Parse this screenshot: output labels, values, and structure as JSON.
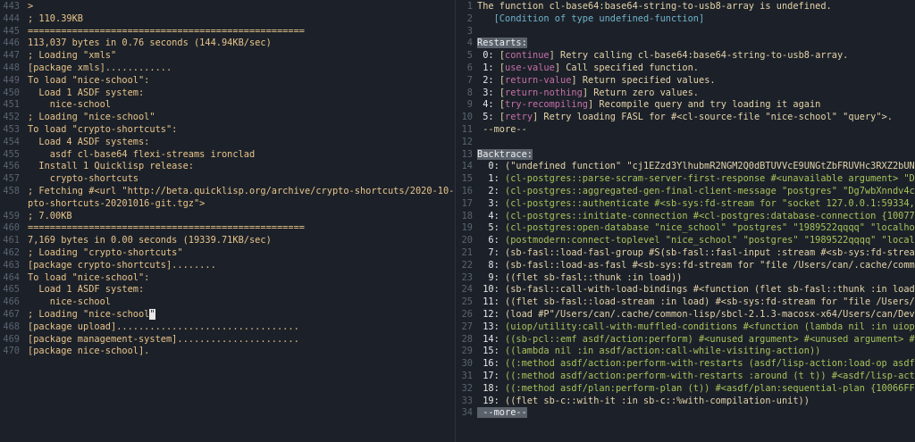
{
  "left_pane": {
    "lines": [
      {
        "n": "443",
        "t": ">"
      },
      {
        "n": "444",
        "t": "; 110.39KB"
      },
      {
        "n": "445",
        "t": "=================================================="
      },
      {
        "n": "446",
        "t": "113,037 bytes in 0.76 seconds (144.94KB/sec)"
      },
      {
        "n": "447",
        "t": "; Loading \"xmls\""
      },
      {
        "n": "448",
        "t": "[package xmls]............"
      },
      {
        "n": "449",
        "t": "To load \"nice-school\":"
      },
      {
        "n": "450",
        "t": "  Load 1 ASDF system:"
      },
      {
        "n": "451",
        "t": "    nice-school"
      },
      {
        "n": "452",
        "t": "; Loading \"nice-school\""
      },
      {
        "n": "453",
        "t": "To load \"crypto-shortcuts\":"
      },
      {
        "n": "454",
        "t": "  Load 4 ASDF systems:"
      },
      {
        "n": "455",
        "t": "    asdf cl-base64 flexi-streams ironclad"
      },
      {
        "n": "456",
        "t": "  Install 1 Quicklisp release:"
      },
      {
        "n": "457",
        "t": "    crypto-shortcuts"
      },
      {
        "n": "458",
        "t": "; Fetching #<url \"http://beta.quicklisp.org/archive/crypto-shortcuts/2020-10-16/cry\\"
      },
      {
        "n": "",
        "t": "pto-shortcuts-20201016-git.tgz\">"
      },
      {
        "n": "459",
        "t": "; 7.00KB"
      },
      {
        "n": "460",
        "t": "=================================================="
      },
      {
        "n": "461",
        "t": "7,169 bytes in 0.00 seconds (19339.71KB/sec)"
      },
      {
        "n": "462",
        "t": "; Loading \"crypto-shortcuts\""
      },
      {
        "n": "463",
        "t": "[package crypto-shortcuts]........"
      },
      {
        "n": "464",
        "t": "To load \"nice-school\":"
      },
      {
        "n": "465",
        "t": "  Load 1 ASDF system:"
      },
      {
        "n": "466",
        "t": "    nice-school"
      },
      {
        "n": "467",
        "t": "; Loading \"nice-school\"",
        "cursor": true
      },
      {
        "n": "468",
        "t": "[package upload]................................."
      },
      {
        "n": "469",
        "t": "[package management-system]......................"
      },
      {
        "n": "470",
        "t": "[package nice-school]."
      }
    ]
  },
  "right_pane": {
    "lines": [
      {
        "n": "1",
        "segs": [
          {
            "t": "The function cl-base64:base64-string-to-usb8-array is undefined.",
            "c": "c-default"
          }
        ]
      },
      {
        "n": "2",
        "segs": [
          {
            "t": "   [Condition of type undefined-function]",
            "c": "c-cyan"
          }
        ]
      },
      {
        "n": "3",
        "segs": []
      },
      {
        "n": "4",
        "segs": [
          {
            "t": "Restarts:",
            "c": "hl"
          }
        ]
      },
      {
        "n": "5",
        "segs": [
          {
            "t": " 0: ",
            "c": "c-white"
          },
          {
            "t": "[",
            "c": "c-default"
          },
          {
            "t": "continue",
            "c": "c-magenta"
          },
          {
            "t": "] Retry calling cl-base64:base64-string-to-usb8-array.",
            "c": "c-default"
          }
        ]
      },
      {
        "n": "6",
        "segs": [
          {
            "t": " 1: ",
            "c": "c-white"
          },
          {
            "t": "[",
            "c": "c-default"
          },
          {
            "t": "use-value",
            "c": "c-magenta"
          },
          {
            "t": "] Call specified function.",
            "c": "c-default"
          }
        ]
      },
      {
        "n": "7",
        "segs": [
          {
            "t": " 2: ",
            "c": "c-white"
          },
          {
            "t": "[",
            "c": "c-default"
          },
          {
            "t": "return-value",
            "c": "c-magenta"
          },
          {
            "t": "] Return specified values.",
            "c": "c-default"
          }
        ]
      },
      {
        "n": "8",
        "segs": [
          {
            "t": " 3: ",
            "c": "c-white"
          },
          {
            "t": "[",
            "c": "c-default"
          },
          {
            "t": "return-nothing",
            "c": "c-magenta"
          },
          {
            "t": "] Return zero values.",
            "c": "c-default"
          }
        ]
      },
      {
        "n": "9",
        "segs": [
          {
            "t": " 4: ",
            "c": "c-white"
          },
          {
            "t": "[",
            "c": "c-default"
          },
          {
            "t": "try-recompiling",
            "c": "c-magenta"
          },
          {
            "t": "] Recompile query and try loading it again",
            "c": "c-default"
          }
        ]
      },
      {
        "n": "10",
        "segs": [
          {
            "t": " 5: ",
            "c": "c-white"
          },
          {
            "t": "[",
            "c": "c-default"
          },
          {
            "t": "retry",
            "c": "c-magenta"
          },
          {
            "t": "] Retry loading FASL for #<cl-source-file \"nice-school\" \"query\">.",
            "c": "c-default"
          }
        ]
      },
      {
        "n": "11",
        "segs": [
          {
            "t": " --more--",
            "c": "c-default"
          }
        ]
      },
      {
        "n": "12",
        "segs": []
      },
      {
        "n": "13",
        "segs": [
          {
            "t": "Backtrace:",
            "c": "hl"
          }
        ]
      },
      {
        "n": "14",
        "segs": [
          {
            "t": "  0: ",
            "c": "c-white"
          },
          {
            "t": "(\"undefined function\" \"cj1EZzd3YlhubmR2NGM2Q0dBTUVVcE9UNGtZbFRUVHc3RXZ2bUNnUEZrT$",
            "c": "c-default"
          }
        ]
      },
      {
        "n": "15",
        "segs": [
          {
            "t": "  1: ",
            "c": "c-white"
          },
          {
            "t": "(cl-postgres::parse-scram-server-first-response #<unavailable argument> \"Dg7wbXn$",
            "c": "c-green"
          }
        ]
      },
      {
        "n": "16",
        "segs": [
          {
            "t": "  2: ",
            "c": "c-white"
          },
          {
            "t": "(cl-postgres::aggregated-gen-final-client-message \"postgres\" \"Dg7wbXnndv4c6CGAME$",
            "c": "c-green"
          }
        ]
      },
      {
        "n": "17",
        "segs": [
          {
            "t": "  3: ",
            "c": "c-white"
          },
          {
            "t": "(cl-postgres::authenticate #<sb-sys:fd-stream for \"socket 127.0.0.1:59334, peer:$",
            "c": "c-green"
          }
        ]
      },
      {
        "n": "18",
        "segs": [
          {
            "t": "  4: ",
            "c": "c-white"
          },
          {
            "t": "(cl-postgres::initiate-connection #<cl-postgres:database-connection {100775A4F3}$",
            "c": "c-green"
          }
        ]
      },
      {
        "n": "19",
        "segs": [
          {
            "t": "  5: ",
            "c": "c-white"
          },
          {
            "t": "(cl-postgres:open-database \"nice_school\" \"postgres\" \"1989522qqqq\" \"localhost\" 54$",
            "c": "c-green"
          }
        ]
      },
      {
        "n": "20",
        "segs": [
          {
            "t": "  6: ",
            "c": "c-white"
          },
          {
            "t": "(postmodern:connect-toplevel \"nice_school\" \"postgres\" \"1989522qqqq\" \"localhost\" $",
            "c": "c-green"
          }
        ]
      },
      {
        "n": "21",
        "segs": [
          {
            "t": "  7: ",
            "c": "c-white"
          },
          {
            "t": "(sb-fasl::load-fasl-group #S(sb-fasl::fasl-input :stream #<sb-sys:fd-stream for $",
            "c": "c-default"
          }
        ]
      },
      {
        "n": "22",
        "segs": [
          {
            "t": "  8: ",
            "c": "c-white"
          },
          {
            "t": "(sb-fasl::load-as-fasl #<sb-sys:fd-stream for \"file /Users/can/.cache/common-lis$",
            "c": "c-default"
          }
        ]
      },
      {
        "n": "23",
        "segs": [
          {
            "t": "  9: ",
            "c": "c-white"
          },
          {
            "t": "((flet sb-fasl::thunk :in load))",
            "c": "c-default"
          }
        ]
      },
      {
        "n": "24",
        "segs": [
          {
            "t": " 10: ",
            "c": "c-white"
          },
          {
            "t": "(sb-fasl::call-with-load-bindings #<function (flet sb-fasl::thunk :in load) {1BA$",
            "c": "c-default"
          }
        ]
      },
      {
        "n": "25",
        "segs": [
          {
            "t": " 11: ",
            "c": "c-white"
          },
          {
            "t": "((flet sb-fasl::load-stream :in load) #<sb-sys:fd-stream for \"file /Users/can/.$",
            "c": "c-default"
          }
        ]
      },
      {
        "n": "26",
        "segs": [
          {
            "t": " 12: ",
            "c": "c-white"
          },
          {
            "t": "(load #P\"/Users/can/.cache/common-lisp/sbcl-2.1.3-macosx-x64/Users/can/Develop/L$",
            "c": "c-default"
          }
        ]
      },
      {
        "n": "27",
        "segs": [
          {
            "t": " 13: ",
            "c": "c-white"
          },
          {
            "t": "(uiop/utility:call-with-muffled-conditions #<function (lambda nil :in uiop/lisp-$",
            "c": "c-green"
          }
        ]
      },
      {
        "n": "28",
        "segs": [
          {
            "t": " 14: ",
            "c": "c-white"
          },
          {
            "t": "((sb-pcl::emf asdf/action:perform) #<unused argument> #<unused argument> #<asdf/$",
            "c": "c-green"
          }
        ]
      },
      {
        "n": "29",
        "segs": [
          {
            "t": " 15: ",
            "c": "c-white"
          },
          {
            "t": "((lambda nil :in asdf/action:call-while-visiting-action))",
            "c": "c-green"
          }
        ]
      },
      {
        "n": "30",
        "segs": [
          {
            "t": " 16: ",
            "c": "c-white"
          },
          {
            "t": "((:method asdf/action:perform-with-restarts (asdf/lisp-action:load-op asdf/lisp-$",
            "c": "c-green"
          }
        ]
      },
      {
        "n": "31",
        "segs": [
          {
            "t": " 17: ",
            "c": "c-white"
          },
          {
            "t": "((:method asdf/action:perform-with-restarts :around (t t)) #<asdf/lisp-action:lo$",
            "c": "c-green"
          }
        ]
      },
      {
        "n": "32",
        "segs": [
          {
            "t": " 18: ",
            "c": "c-white"
          },
          {
            "t": "((:method asdf/plan:perform-plan (t)) #<asdf/plan:sequential-plan {10066FF293}>)$",
            "c": "c-green"
          }
        ]
      },
      {
        "n": "33",
        "segs": [
          {
            "t": " 19: ",
            "c": "c-white"
          },
          {
            "t": "((flet sb-c::with-it :in sb-c::%with-compilation-unit))",
            "c": "c-default"
          }
        ]
      },
      {
        "n": "34",
        "segs": [
          {
            "t": " --more--",
            "c": "hl"
          }
        ]
      }
    ]
  }
}
